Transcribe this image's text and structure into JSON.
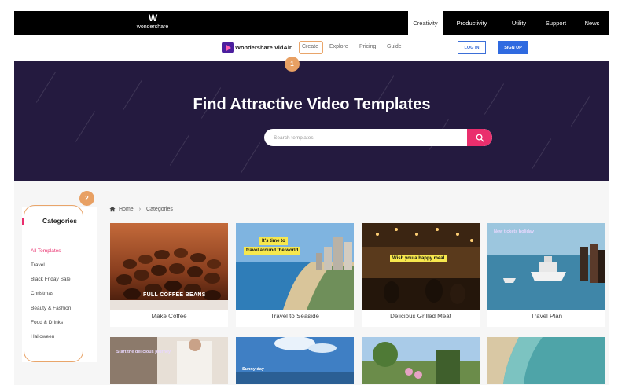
{
  "topbar": {
    "brand_mark": "W",
    "brand_name": "wondershare",
    "nav": [
      "Creativity",
      "Productivity",
      "Utility",
      "Support",
      "News"
    ]
  },
  "subnav": {
    "product": "Wondershare VidAir",
    "links": [
      "Create",
      "Explore",
      "Pricing",
      "Guide"
    ],
    "login": "LOG IN",
    "signup": "SIGN UP",
    "badge1": "1"
  },
  "hero": {
    "title": "Find Attractive Video Templates",
    "search_placeholder": "Search templates"
  },
  "sidebar": {
    "badge2": "2",
    "title": "Categories",
    "items": [
      "All Templates",
      "Travel",
      "Black Friday Sale",
      "Christmas",
      "Beauty & Fashion",
      "Food & Drinks",
      "Halloween"
    ]
  },
  "breadcrumb": {
    "home": "Home",
    "current": "Categories"
  },
  "cards": [
    {
      "label": "Make Coffee",
      "caption": "FULL COFFEE BEANS"
    },
    {
      "label": "Travel to Seaside",
      "tag1": "It's time to",
      "tag2": "travel around the world"
    },
    {
      "label": "Delicious Grilled Meat",
      "tag": "Wish you a happy meal"
    },
    {
      "label": "Travel Plan",
      "caption": "New tickets holiday"
    }
  ],
  "cards_row2": [
    {
      "caption": "Start the delicious journey"
    },
    {
      "caption": "Sunny day"
    },
    {
      "caption": ""
    },
    {
      "caption": ""
    }
  ],
  "colors": {
    "accent": "#ea2e6d",
    "hero_bg": "#241a3f",
    "highlight": "#e9a56a",
    "primary": "#2f6ae0"
  }
}
